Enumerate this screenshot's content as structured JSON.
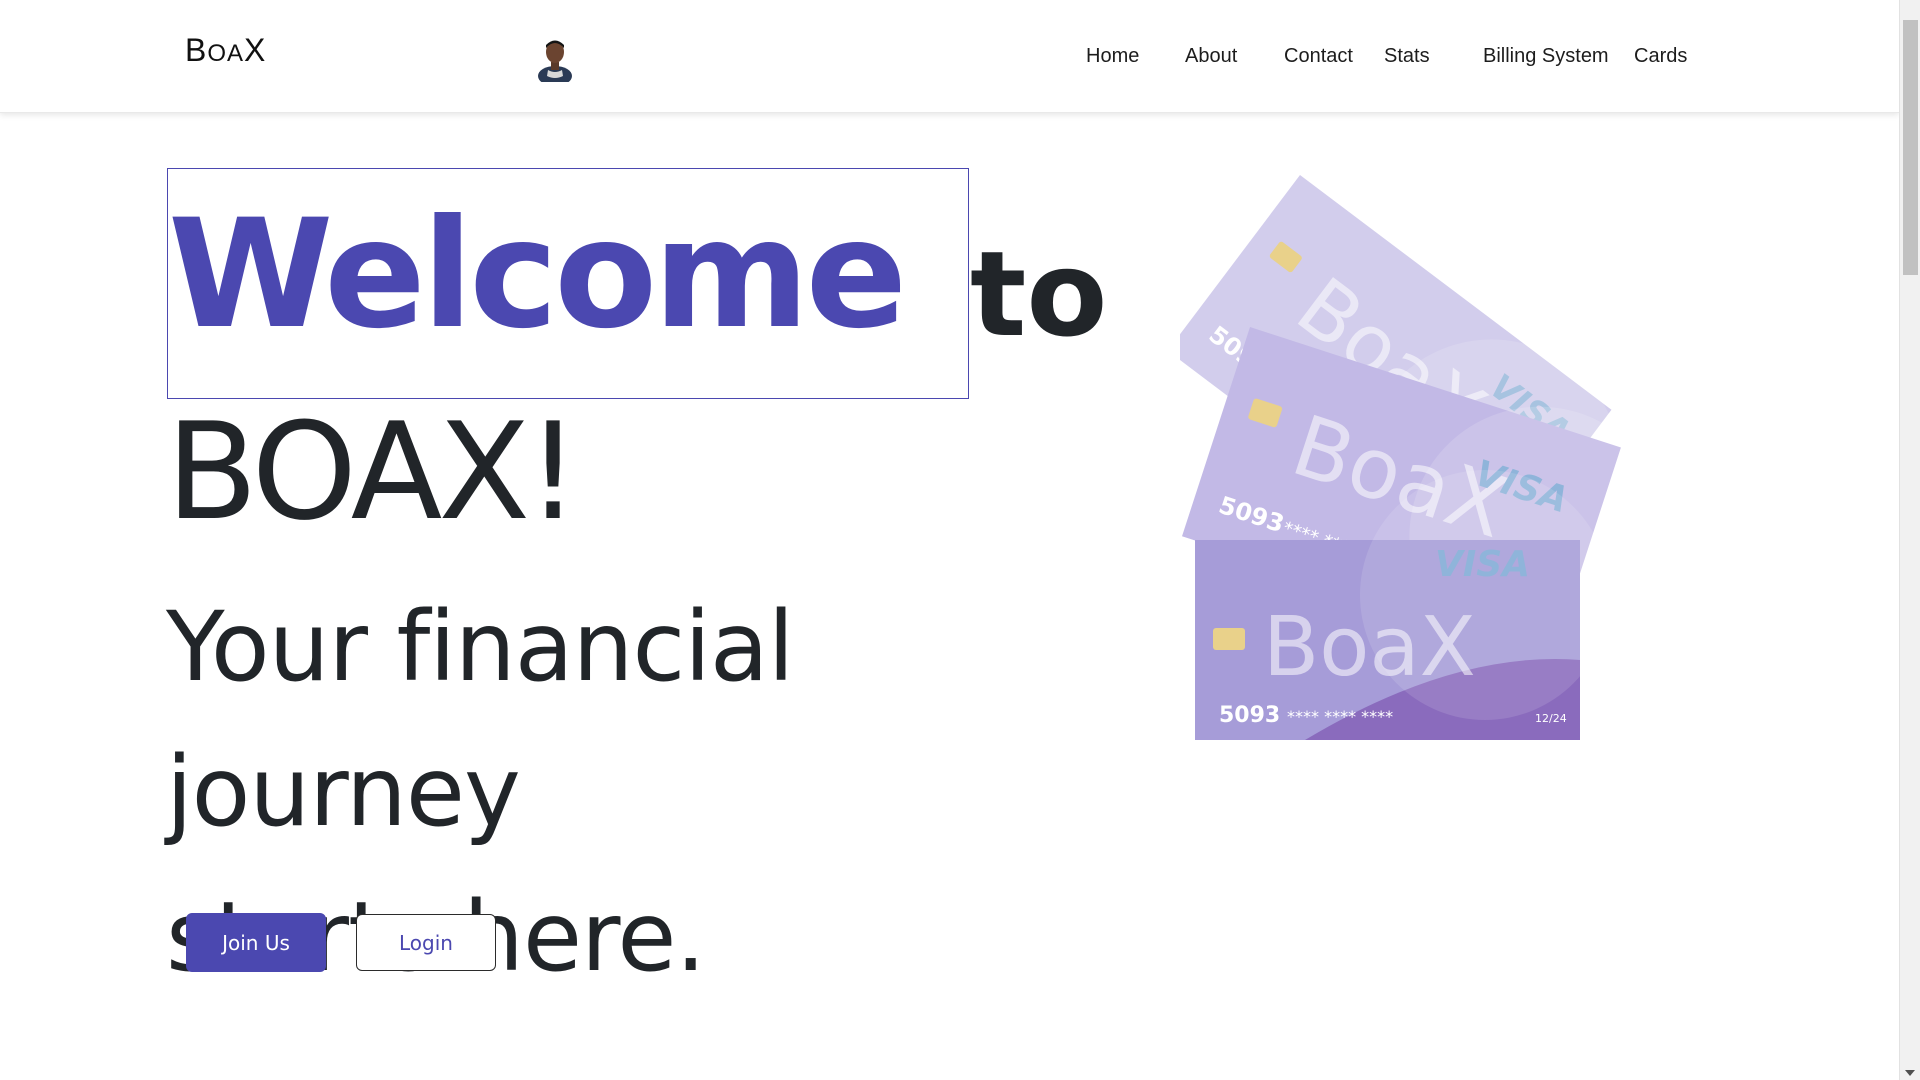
{
  "brand": {
    "logo_text_b": "B",
    "logo_text_oa": "OA",
    "logo_text_x": "X"
  },
  "nav": {
    "items": [
      {
        "label": "Home"
      },
      {
        "label": "About"
      },
      {
        "label": "Contact"
      },
      {
        "label": "Stats"
      },
      {
        "label": "Billing System"
      },
      {
        "label": "Cards"
      }
    ]
  },
  "hero": {
    "welcome": "Welcome",
    "to": "to",
    "brand_name": "BOAX!",
    "tagline_line1": "Your financial journey",
    "tagline_line2": "starts here."
  },
  "buttons": {
    "join_label": "Join Us",
    "login_label": "Login"
  },
  "cards": {
    "brand": "BoaX",
    "network": "VISA",
    "number_prefix": "5093",
    "number_mask": "**** **** ****",
    "expiry": "12/24"
  },
  "colors": {
    "accent": "#4b48b0",
    "text": "#212529",
    "card_front": "#a69cd8",
    "card_middle": "#c2b9e6",
    "card_back": "#d2cdec"
  }
}
